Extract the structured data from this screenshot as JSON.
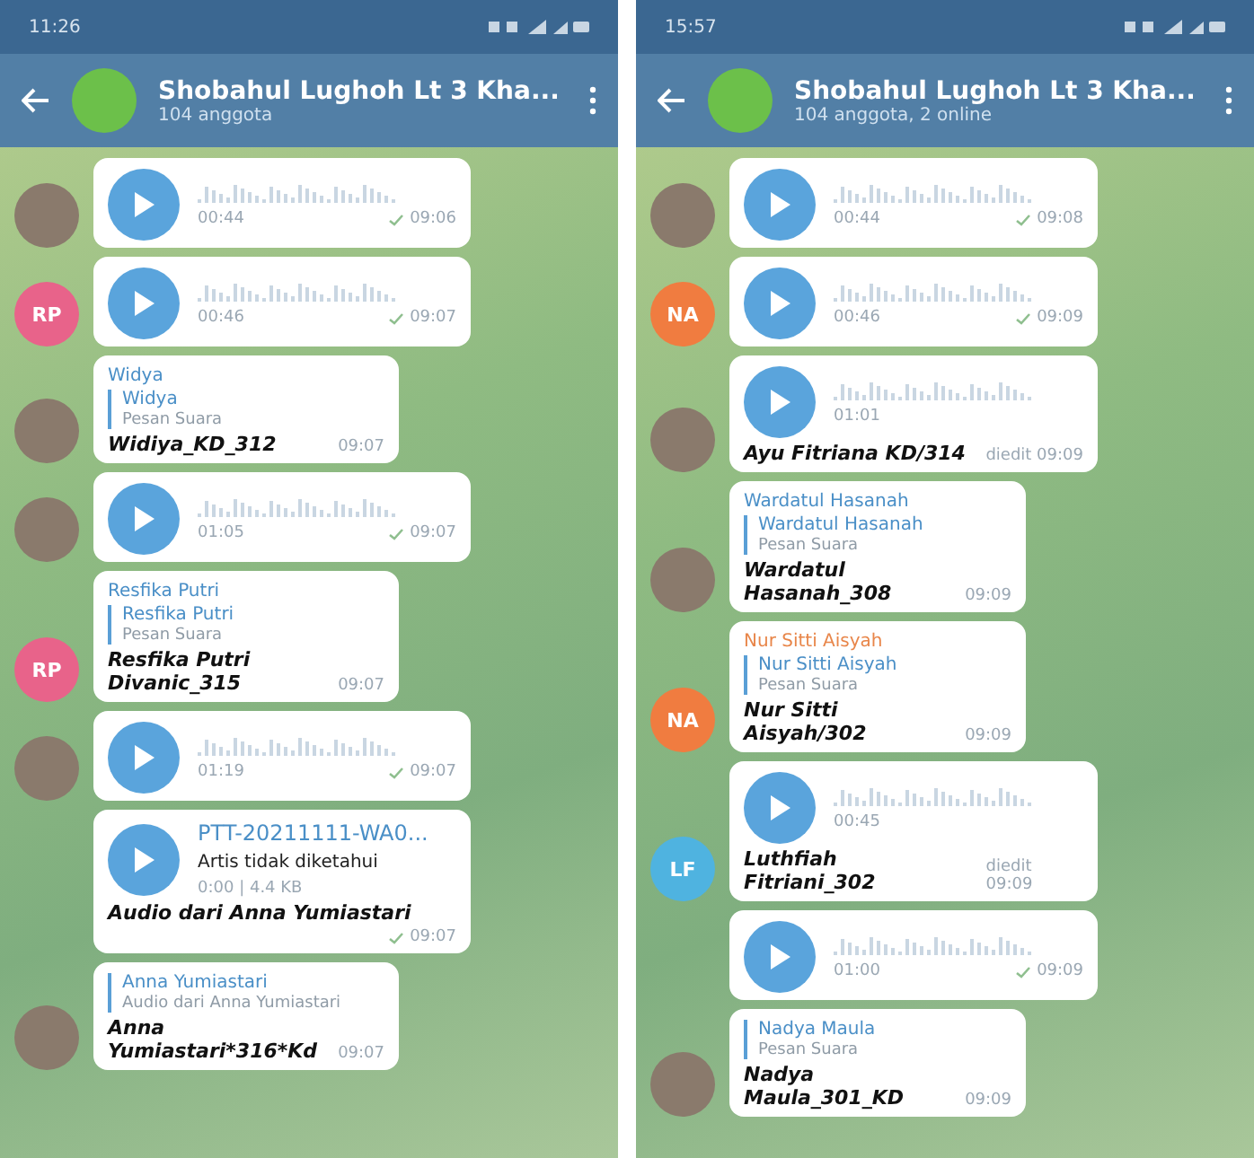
{
  "phones": [
    {
      "status_bar": {
        "time": "11:26"
      },
      "header": {
        "title": "Shobahul Lughoh Lt 3 Kha...",
        "subtitle": "104 anggota"
      },
      "messages": [
        {
          "kind": "voice",
          "avatar": {
            "kind": "photo"
          },
          "duration": "00:44",
          "time": "09:06"
        },
        {
          "kind": "voice",
          "avatar": {
            "kind": "initials",
            "initials": "RP",
            "color": "#e8638a"
          },
          "duration": "00:46",
          "time": "09:07"
        },
        {
          "kind": "reply",
          "avatar": {
            "kind": "photo"
          },
          "sender": "Widya",
          "color": "#4a8fc7",
          "quote_title": "Widya",
          "quote_text": "Pesan Suara",
          "body": "Widiya_KD_312",
          "time": "09:07"
        },
        {
          "kind": "voice",
          "avatar": {
            "kind": "photo"
          },
          "duration": "01:05",
          "time": "09:07"
        },
        {
          "kind": "reply",
          "avatar": {
            "kind": "initials",
            "initials": "RP",
            "color": "#e8638a"
          },
          "sender": "Resfika Putri",
          "color": "#4a8fc7",
          "quote_title": "Resfika Putri",
          "quote_text": "Pesan Suara",
          "body": "Resfika Putri Divanic_315",
          "time": "09:07"
        },
        {
          "kind": "voice",
          "avatar": {
            "kind": "photo"
          },
          "duration": "01:19",
          "time": "09:07"
        },
        {
          "kind": "file",
          "title": "PTT-20211111-WA0...",
          "artist": "Artis tidak diketahui",
          "size": "0:00 | 4.4 KB",
          "caption": "Audio dari Anna Yumiastari",
          "time": "09:07"
        },
        {
          "kind": "reply",
          "avatar": {
            "kind": "photo"
          },
          "quote_title": "Anna Yumiastari",
          "quote_text": "Audio dari Anna Yumiastari",
          "body": "Anna Yumiastari*316*Kd",
          "time": "09:07"
        }
      ]
    },
    {
      "status_bar": {
        "time": "15:57"
      },
      "header": {
        "title": "Shobahul Lughoh Lt 3 Kha...",
        "subtitle": "104 anggota, 2 online"
      },
      "messages": [
        {
          "kind": "voice",
          "avatar": {
            "kind": "photo"
          },
          "duration": "00:44",
          "time": "09:08"
        },
        {
          "kind": "voice",
          "avatar": {
            "kind": "initials",
            "initials": "NA",
            "color": "#f07c40"
          },
          "duration": "00:46",
          "time": "09:09"
        },
        {
          "kind": "voice_caption",
          "avatar": {
            "kind": "photo"
          },
          "duration": "01:01",
          "caption": "Ayu Fitriana KD/314",
          "time": "diedit 09:09"
        },
        {
          "kind": "reply",
          "avatar": {
            "kind": "photo"
          },
          "sender": "Wardatul Hasanah",
          "color": "#4a8fc7",
          "quote_title": "Wardatul Hasanah",
          "quote_text": "Pesan Suara",
          "body": "Wardatul Hasanah_308",
          "time": "09:09"
        },
        {
          "kind": "reply",
          "avatar": {
            "kind": "initials",
            "initials": "NA",
            "color": "#f07c40"
          },
          "sender": "Nur Sitti Aisyah",
          "color": "#e8864a",
          "quote_title": "Nur Sitti Aisyah",
          "quote_text": "Pesan Suara",
          "body": "Nur Sitti Aisyah/302",
          "time": "09:09"
        },
        {
          "kind": "voice_caption",
          "avatar": {
            "kind": "initials",
            "initials": "LF",
            "color": "#4fb3e0"
          },
          "duration": "00:45",
          "caption": "Luthfiah Fitriani_302",
          "time": "diedit 09:09"
        },
        {
          "kind": "voice",
          "duration": "01:00",
          "time": "09:09"
        },
        {
          "kind": "reply",
          "avatar": {
            "kind": "photo"
          },
          "quote_title": "Nadya Maula",
          "quote_text": "Pesan Suara",
          "body": "Nadya Maula_301_KD",
          "time": "09:09"
        }
      ]
    }
  ]
}
